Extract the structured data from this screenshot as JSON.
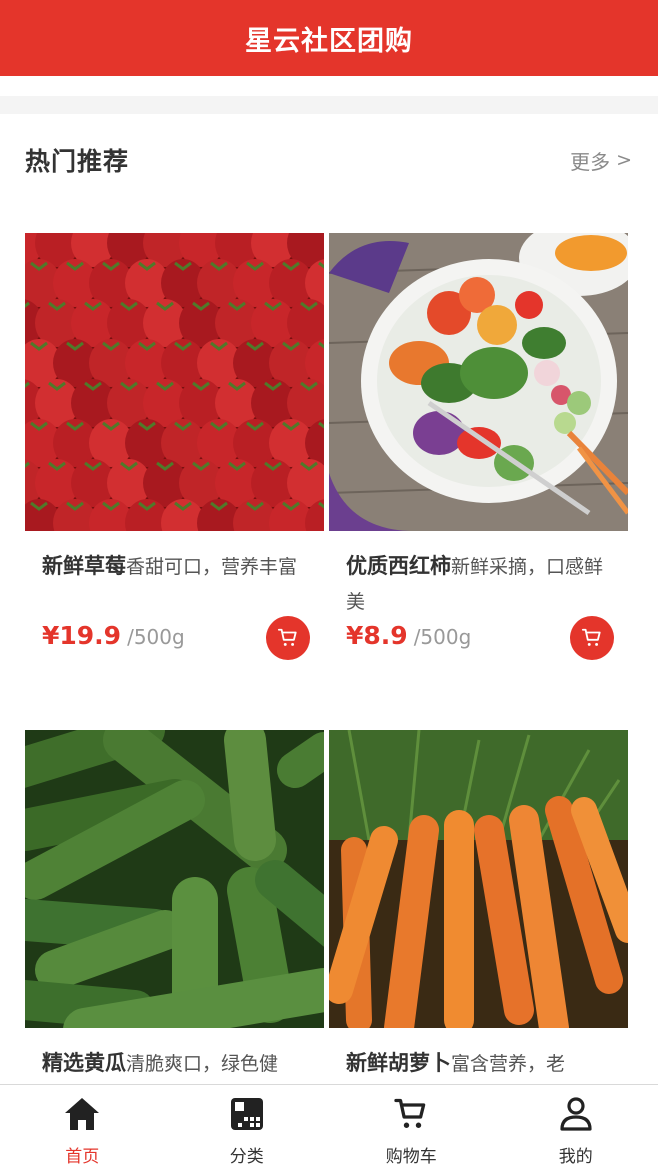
{
  "header": {
    "title": "星云社区团购"
  },
  "section": {
    "title": "热门推荐",
    "more_label": "更多",
    "more_chevron": ">"
  },
  "products": [
    {
      "name": "新鲜草莓",
      "desc": "香甜可口，营养丰富",
      "price": "¥19.9",
      "unit": "/500g",
      "image": "strawberries"
    },
    {
      "name": "优质西红柿",
      "desc": "新鲜采摘，口感鲜美",
      "price": "¥8.9",
      "unit": "/500g",
      "image": "salad-bowl"
    },
    {
      "name": "精选黄瓜",
      "desc": "清脆爽口，绿色健",
      "price": "",
      "unit": "",
      "image": "cucumbers"
    },
    {
      "name": "新鲜胡萝卜",
      "desc": "富含营养，老",
      "price": "",
      "unit": "",
      "image": "carrots"
    }
  ],
  "tabbar": [
    {
      "label": "首页",
      "icon": "home-icon",
      "active": true
    },
    {
      "label": "分类",
      "icon": "category-icon",
      "active": false
    },
    {
      "label": "购物车",
      "icon": "cart-icon",
      "active": false
    },
    {
      "label": "我的",
      "icon": "user-icon",
      "active": false
    }
  ],
  "colors": {
    "brand": "#e4352b",
    "text": "#333333",
    "muted": "#999999"
  }
}
